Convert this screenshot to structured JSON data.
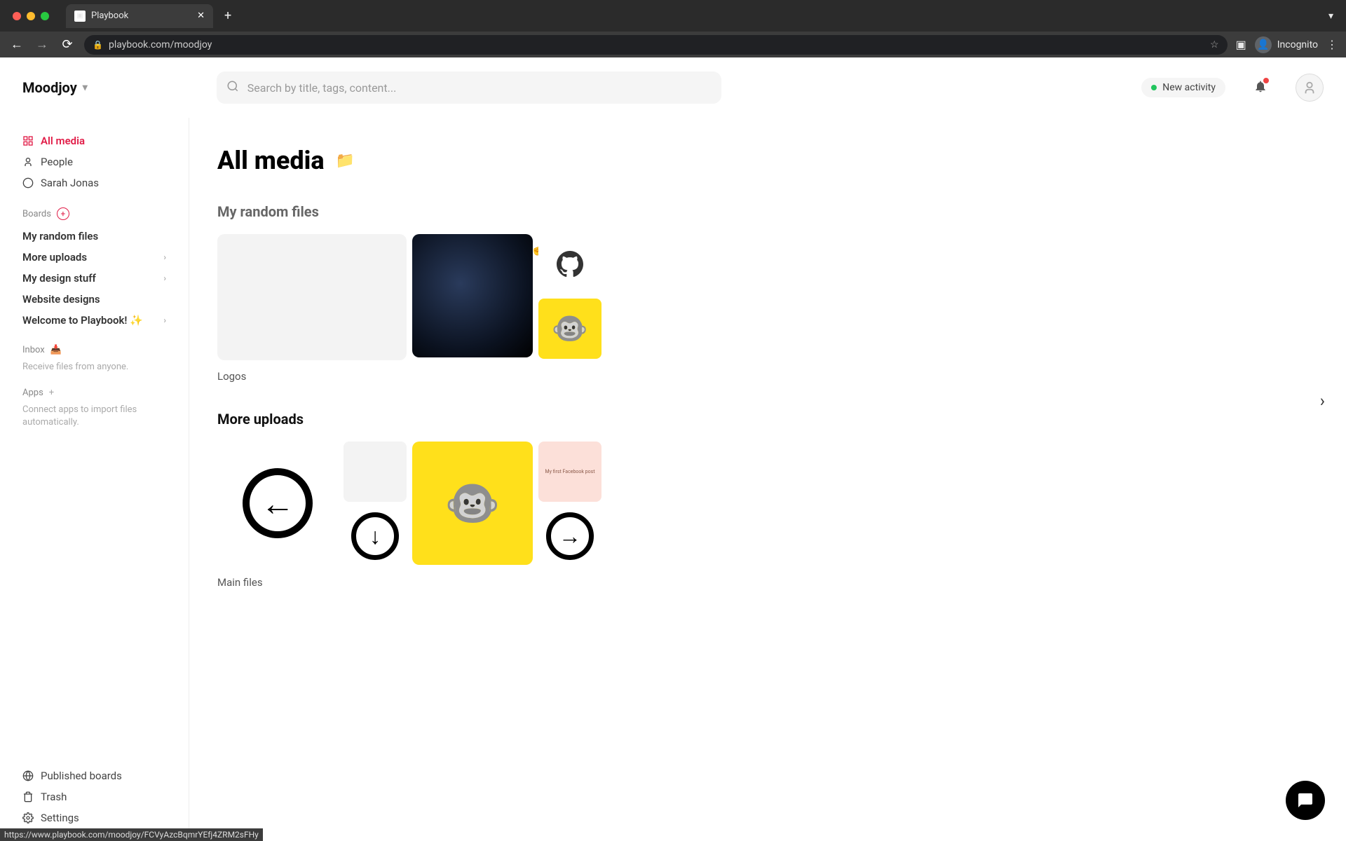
{
  "browser": {
    "tab_title": "Playbook",
    "url": "playbook.com/moodjoy",
    "incognito_label": "Incognito",
    "status_link": "https://www.playbook.com/moodjoy/FCVyAzcBqmrYEfj4ZRM2sFHy"
  },
  "header": {
    "workspace": "Moodjoy",
    "search_placeholder": "Search by title, tags, content...",
    "activity_badge": "New activity"
  },
  "sidebar": {
    "nav": [
      {
        "label": "All media",
        "active": true
      },
      {
        "label": "People",
        "active": false
      },
      {
        "label": "Sarah Jonas",
        "active": false
      }
    ],
    "boards_header": "Boards",
    "boards": [
      {
        "label": "My random files",
        "bold": true,
        "expandable": false
      },
      {
        "label": "More uploads",
        "bold": true,
        "expandable": true
      },
      {
        "label": "My design stuff",
        "bold": true,
        "expandable": true
      },
      {
        "label": "Website designs",
        "bold": true,
        "expandable": false
      },
      {
        "label": "Welcome to Playbook! ✨",
        "bold": true,
        "expandable": true
      }
    ],
    "inbox_header": "Inbox",
    "inbox_desc": "Receive files from anyone.",
    "apps_header": "Apps",
    "apps_desc": "Connect apps to import files automatically.",
    "bottom": [
      {
        "label": "Published boards"
      },
      {
        "label": "Trash"
      },
      {
        "label": "Settings"
      }
    ]
  },
  "main": {
    "page_title": "All media",
    "sections": [
      {
        "title": "My random files",
        "collection": "Logos"
      },
      {
        "title": "More uploads",
        "collection": "Main files"
      }
    ]
  }
}
